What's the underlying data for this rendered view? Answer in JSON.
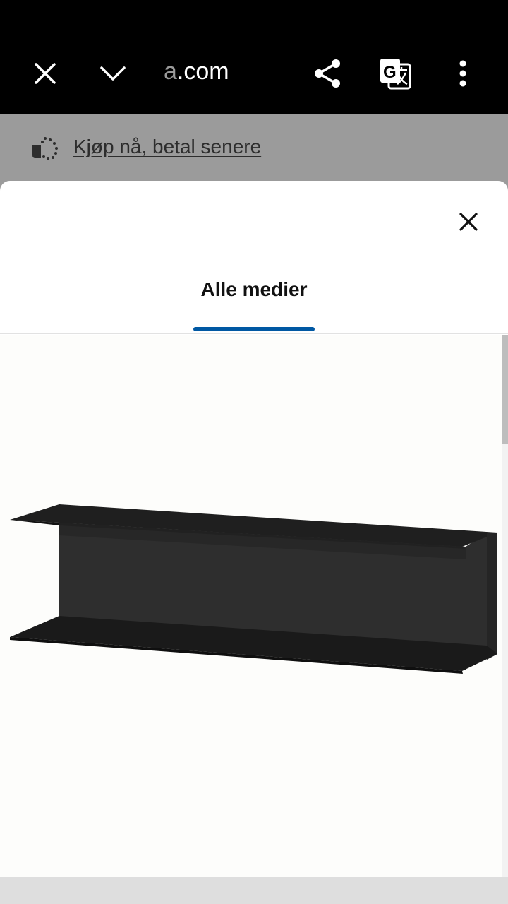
{
  "browser": {
    "url_faded_part": "a",
    "url_visible_part": ".com",
    "icons": [
      "close-icon",
      "chevron-down-icon",
      "share-icon",
      "translate-icon",
      "more-vertical-icon"
    ]
  },
  "promo": {
    "link_text": "Kjøp nå, betal senere",
    "icon": "payment-later-icon"
  },
  "modal": {
    "tabs": [
      {
        "label": "Alle medier",
        "active": true
      }
    ],
    "close_icon": "close-icon",
    "accent_color": "#0058a3",
    "image": "black-wall-shelf-image"
  }
}
